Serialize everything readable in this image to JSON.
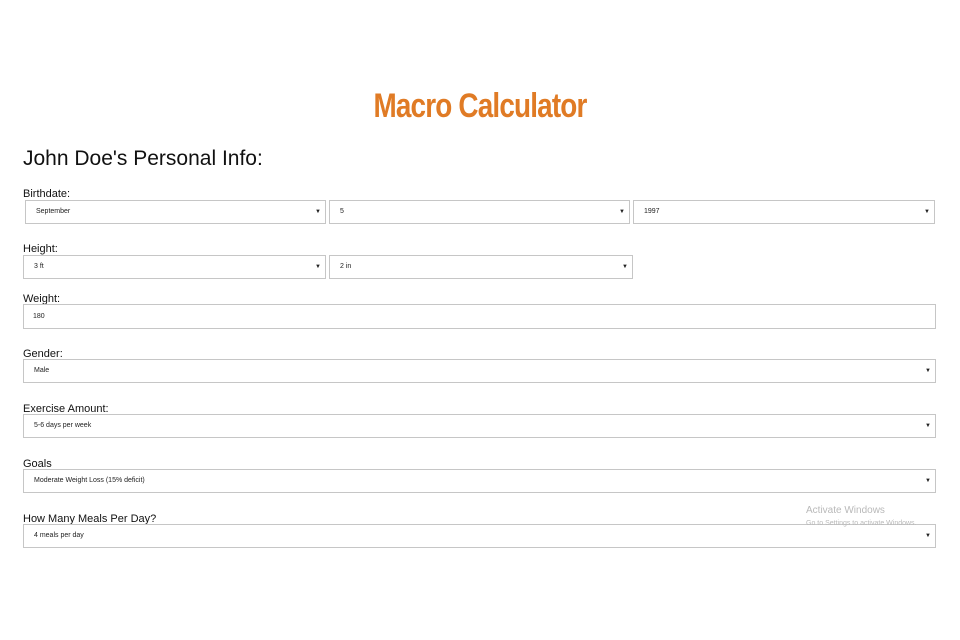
{
  "app": {
    "title": "Macro Calculator",
    "accent_color": "#e07b25"
  },
  "section": {
    "heading": "John Doe's Personal Info:"
  },
  "birthdate": {
    "label": "Birthdate:",
    "month": "September",
    "day": "5",
    "year": "1997"
  },
  "height": {
    "label": "Height:",
    "feet": "3 ft",
    "inches": "2 in"
  },
  "weight": {
    "label": "Weight:",
    "value": "180"
  },
  "gender": {
    "label": "Gender:",
    "value": "Male"
  },
  "exercise": {
    "label": "Exercise Amount:",
    "value": "5-6 days per week"
  },
  "goals": {
    "label": "Goals",
    "value": "Moderate Weight Loss (15% deficit)"
  },
  "meals": {
    "label": "How Many Meals Per Day?",
    "value": "4 meals per day"
  },
  "icons": {
    "dropdown_caret": "▼"
  },
  "watermark": {
    "title": "Activate Windows",
    "subtitle": "Go to Settings to activate Windows."
  }
}
